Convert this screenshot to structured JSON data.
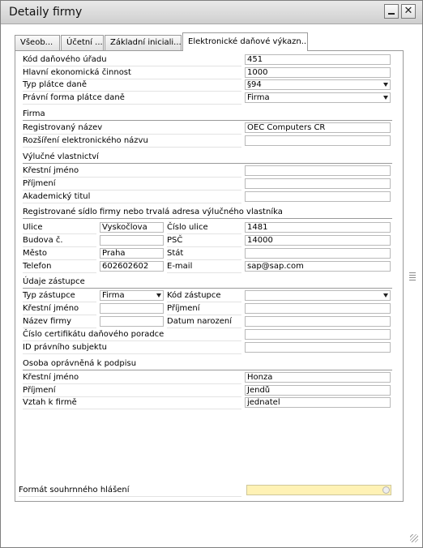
{
  "window": {
    "title": "Detaily firmy"
  },
  "tabs": [
    {
      "label": "Všeob..."
    },
    {
      "label": "Účetní ..."
    },
    {
      "label": "Základní iniciali..."
    },
    {
      "label": "Elektronické daňové výkazn..."
    }
  ],
  "general": {
    "office_code": {
      "label": "Kód daňového úřadu",
      "value": "451"
    },
    "main_activity": {
      "label": "Hlavní ekonomická činnost",
      "value": "1000"
    },
    "payer_type": {
      "label": "Typ plátce daně",
      "value": "§94"
    },
    "payer_legal_form": {
      "label": "Právní forma plátce daně",
      "value": "Firma"
    }
  },
  "firm": {
    "heading": "Firma",
    "reg_name": {
      "label": "Registrovaný název",
      "value": "OEC Computers ČR"
    },
    "ext_name": {
      "label": "Rozšíření elektronického názvu",
      "value": ""
    }
  },
  "owner": {
    "heading": "Výlučné vlastnictví",
    "first_name": {
      "label": "Křestní jméno",
      "value": ""
    },
    "last_name": {
      "label": "Příjmení",
      "value": ""
    },
    "title": {
      "label": "Akademický titul",
      "value": ""
    }
  },
  "address": {
    "heading": "Registrované sídlo firmy nebo trvalá adresa výlučného vlastníka",
    "street": {
      "label": "Ulice",
      "value": "Vyskočlova"
    },
    "street_no": {
      "label": "Číslo ulice",
      "value": "1481"
    },
    "building": {
      "label": "Budova č.",
      "value": ""
    },
    "zip": {
      "label": "PSČ",
      "value": "14000"
    },
    "city": {
      "label": "Město",
      "value": "Praha"
    },
    "country": {
      "label": "Stát",
      "value": ""
    },
    "phone": {
      "label": "Telefon",
      "value": "602602602"
    },
    "email": {
      "label": "E-mail",
      "value": "sap@sap.com"
    }
  },
  "agent": {
    "heading": "Údaje zástupce",
    "type": {
      "label": "Typ zástupce",
      "value": "Firma"
    },
    "code": {
      "label": "Kód zástupce",
      "value": ""
    },
    "first_name": {
      "label": "Křestní jméno",
      "value": ""
    },
    "last_name": {
      "label": "Příjmení",
      "value": ""
    },
    "firm_name": {
      "label": "Název firmy",
      "value": ""
    },
    "birth_date": {
      "label": "Datum narození",
      "value": ""
    },
    "cert_no": {
      "label": "Číslo certifikátu daňového poradce",
      "value": ""
    },
    "legal_id": {
      "label": "ID právního subjektu",
      "value": ""
    }
  },
  "signatory": {
    "heading": "Osoba oprávněná k podpisu",
    "first_name": {
      "label": "Křestní jméno",
      "value": "Honza"
    },
    "last_name": {
      "label": "Příjmení",
      "value": "Jendů"
    },
    "relation": {
      "label": "Vztah k firmě",
      "value": "jednatel"
    }
  },
  "summary_format": {
    "label": "Formát souhrnného hlášení",
    "value": ""
  },
  "colors": {
    "active_field": "#fff2b5",
    "title_bar": "#dcdcdc",
    "border": "#9a9a9a"
  }
}
